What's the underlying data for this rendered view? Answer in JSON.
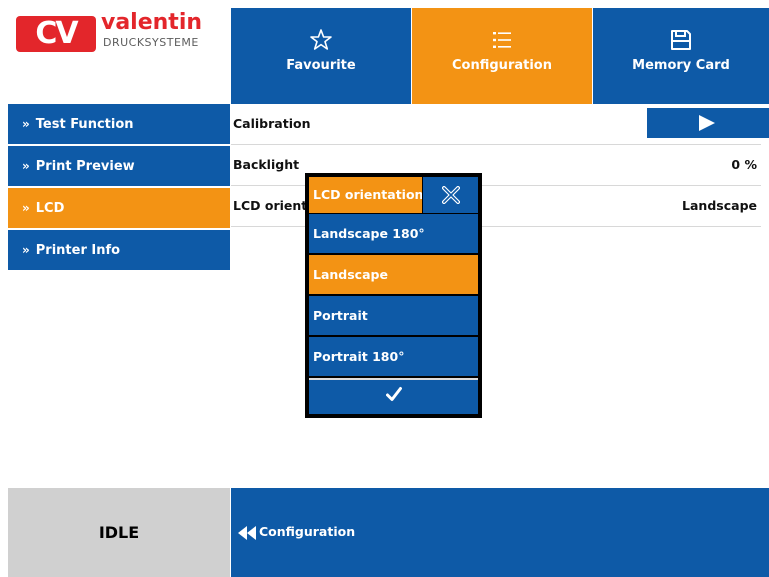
{
  "brand": {
    "name": "valentin",
    "sub": "DRUCKSYSTEME",
    "mark": "CV"
  },
  "tiles": {
    "favourite": "Favourite",
    "configuration": "Configuration",
    "memory_card": "Memory Card"
  },
  "sidebar": {
    "items": [
      {
        "label": "Test Function",
        "active": false
      },
      {
        "label": "Print Preview",
        "active": false
      },
      {
        "label": "LCD",
        "active": true
      },
      {
        "label": "Printer Info",
        "active": false
      }
    ]
  },
  "settings": {
    "rows": [
      {
        "label": "Calibration",
        "value": ""
      },
      {
        "label": "Backlight",
        "value": "0 %"
      },
      {
        "label": "LCD orient",
        "value": "Landscape"
      }
    ]
  },
  "dialog": {
    "title": "LCD orientation",
    "options": [
      "Landscape 180°",
      "Landscape",
      "Portrait",
      "Portrait 180°"
    ],
    "selected": "Landscape"
  },
  "footer": {
    "status": "IDLE",
    "back_label": "Configuration"
  },
  "colors": {
    "blue": "#0e5aa7",
    "orange": "#f39314",
    "brand_red": "#e3262b",
    "status_gray": "#d0d0d0"
  },
  "icons": {
    "favourite": "star-outline-icon",
    "configuration": "list-icon",
    "memory_card": "floppy-icon",
    "calibrate": "play-icon",
    "close": "close-icon",
    "confirm": "check-icon",
    "back": "double-arrow-left-icon"
  }
}
